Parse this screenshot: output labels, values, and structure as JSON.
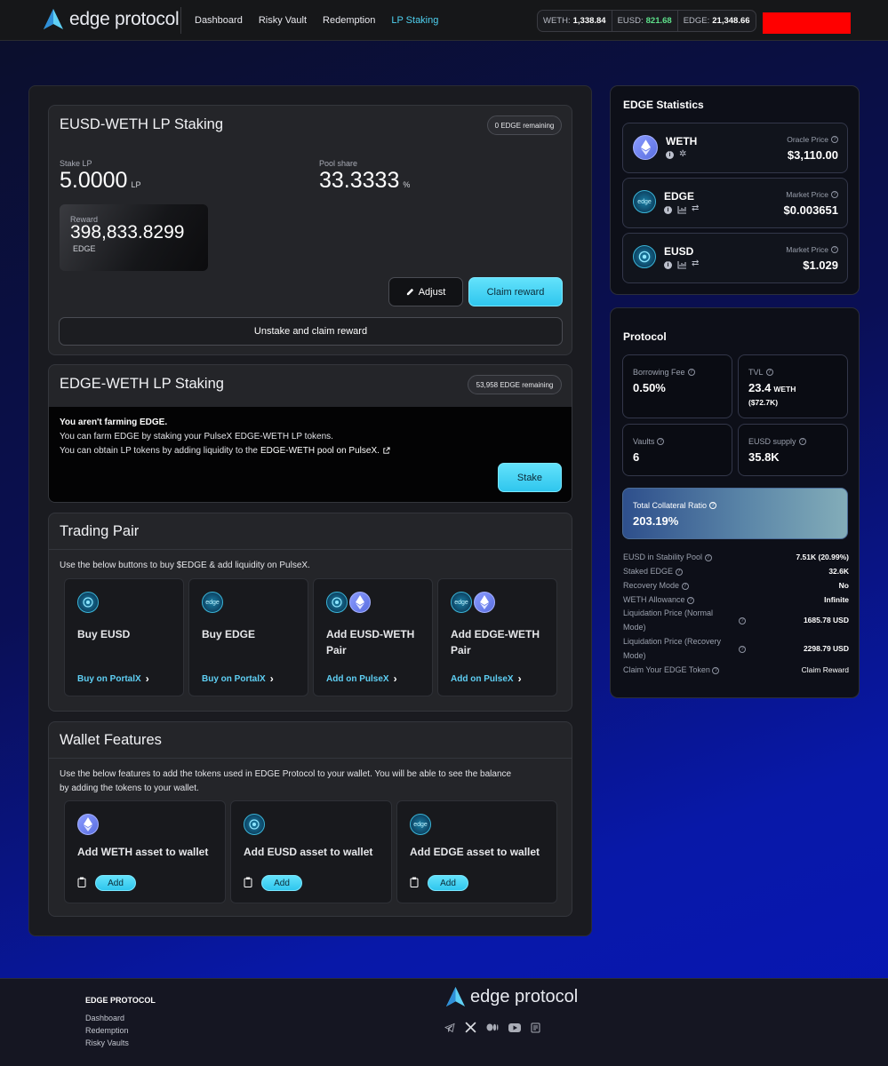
{
  "nav": {
    "logo_text": "edge protocol",
    "links": [
      "Dashboard",
      "Risky Vault",
      "Redemption",
      "LP Staking"
    ],
    "prices": [
      {
        "label": "WETH:",
        "value": "1,338.84"
      },
      {
        "label": "EUSD:",
        "value": "821.68"
      },
      {
        "label": "EDGE:",
        "value": "21,348.66"
      }
    ]
  },
  "eusd_weth": {
    "title": "EUSD-WETH LP Staking",
    "badge": "0 EDGE remaining",
    "stake_label": "Stake LP",
    "stake_value": "5.0000",
    "stake_unit": "LP",
    "pool_label": "Pool share",
    "pool_value": "33.3333",
    "pool_unit": "%",
    "reward_label": "Reward",
    "reward_value": "398,833.8299",
    "reward_unit": "EDGE",
    "adjust": "Adjust",
    "claim": "Claim reward",
    "unstake": "Unstake and claim reward"
  },
  "edge_weth": {
    "title": "EDGE-WETH LP Staking",
    "badge": "53,958 EDGE remaining",
    "line1": "You aren't farming EDGE.",
    "line2": "You can farm EDGE by staking your PulseX EDGE-WETH LP tokens.",
    "line3a": "You can obtain LP tokens by adding liquidity to the",
    "line3b": "EDGE-WETH pool on PulseX.",
    "stake": "Stake"
  },
  "trading": {
    "title": "Trading Pair",
    "desc": "Use the below buttons to buy $EDGE & add liquidity on PulseX.",
    "items": [
      {
        "title1": "Buy EUSD",
        "title2": "",
        "link": "Buy on PortalX"
      },
      {
        "title1": "Buy EDGE",
        "title2": "",
        "link": "Buy on PortalX"
      },
      {
        "title1": "Add EUSD-WETH",
        "title2": "Pair",
        "link": "Add on PulseX"
      },
      {
        "title1": "Add EDGE-WETH",
        "title2": "Pair",
        "link": "Add on PulseX"
      }
    ]
  },
  "wallet": {
    "title": "Wallet Features",
    "desc1": "Use the below features to add the tokens used in EDGE Protocol to your wallet. You will be able to see the balance",
    "desc2": "by adding the tokens to your wallet.",
    "items": [
      {
        "title": "Add WETH asset to wallet",
        "btn": "Add"
      },
      {
        "title": "Add EUSD asset to wallet",
        "btn": "Add"
      },
      {
        "title": "Add EDGE asset to wallet",
        "btn": "Add"
      }
    ]
  },
  "stats": {
    "title": "EDGE Statistics",
    "tokens": [
      {
        "name": "WETH",
        "price_label": "Oracle Price",
        "price": "$3,110.00"
      },
      {
        "name": "EDGE",
        "price_label": "Market Price",
        "price": "$0.003651"
      },
      {
        "name": "EUSD",
        "price_label": "Market Price",
        "price": "$1.029"
      }
    ]
  },
  "protocol": {
    "title": "Protocol",
    "borrowing_fee_label": "Borrowing Fee",
    "borrowing_fee": "0.50%",
    "tvl_label": "TVL",
    "tvl_value": "23.4",
    "tvl_unit": "WETH",
    "tvl_usd": "($72.7K)",
    "vaults_label": "Vaults",
    "vaults": "6",
    "eusd_supply_label": "EUSD supply",
    "eusd_supply": "35.8K",
    "tcr_label": "Total Collateral Ratio",
    "tcr": "203.19%",
    "rows": [
      {
        "k": "EUSD in Stability Pool",
        "v": "7.51K (20.99%)"
      },
      {
        "k": "Staked EDGE",
        "v": "32.6K"
      },
      {
        "k": "Recovery Mode",
        "v": "No"
      },
      {
        "k": "WETH Allowance",
        "v": "Infinite"
      }
    ],
    "liq_normal_a": "Liquidation Price (Normal",
    "liq_normal_b": "Mode)",
    "liq_normal_v": "1685.78 USD",
    "liq_recovery_a": "Liquidation Price (Recovery",
    "liq_recovery_b": "Mode)",
    "liq_recovery_v": "2298.79 USD",
    "claim_label": "Claim Your EDGE Token",
    "claim_value": "Claim Reward"
  },
  "footer": {
    "brand": "EDGE PROTOCOL",
    "links": [
      "Dashboard",
      "Redemption",
      "Risky Vaults"
    ],
    "logo_text": "edge protocol"
  }
}
